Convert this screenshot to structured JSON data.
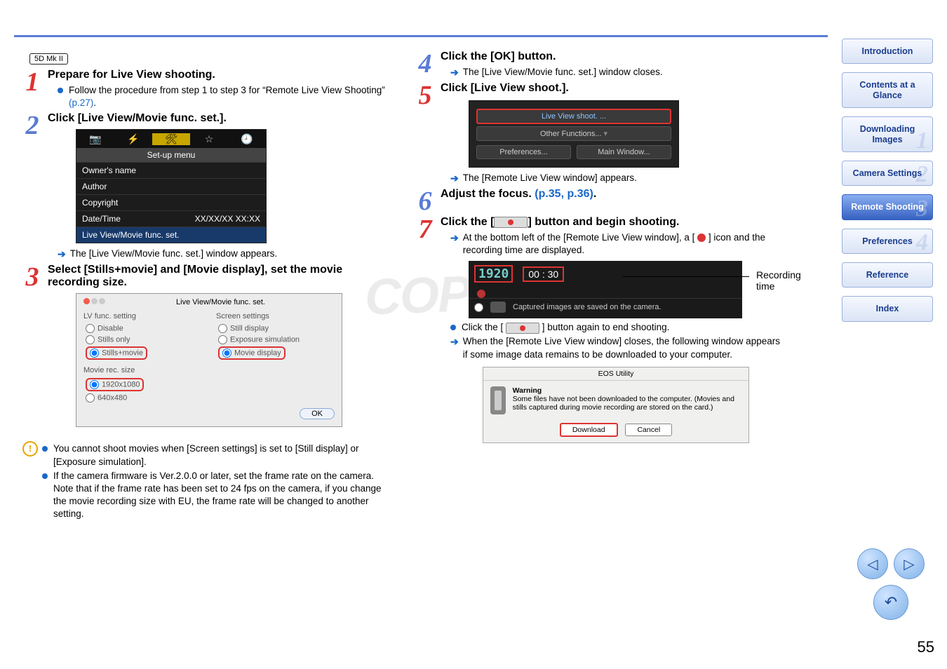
{
  "camera_badge": "5D Mk II",
  "leftcol": {
    "step1": {
      "title": "Prepare for Live View shooting.",
      "b1a": "Follow the procedure from step 1 to step 3 for “Remote Live View Shooting” ",
      "b1link": "(p.27)",
      "b1b": "."
    },
    "step2": {
      "title": "Click [Live View/Movie func. set.].",
      "sub": "The [Live View/Movie func. set.] window appears."
    },
    "step3": {
      "title": "Select [Stills+movie] and [Movie display], set the movie recording size."
    },
    "shot1": {
      "setup": "Set-up menu",
      "rows": [
        "Owner's name",
        "Author",
        "Copyright"
      ],
      "dt_label": "Date/Time",
      "dt_val": "XX/XX/XX XX:XX",
      "sel": "Live View/Movie func. set."
    },
    "shot2": {
      "title": "Live View/Movie func. set.",
      "lv_h": "LV func. setting",
      "sc_h": "Screen settings",
      "lv1": "Disable",
      "lv2": "Stills only",
      "lv3": "Stills+movie",
      "sc1": "Still display",
      "sc2": "Exposure simulation",
      "sc3": "Movie display",
      "mrs_h": "Movie rec. size",
      "mrs1": "1920x1080",
      "mrs2": "640x480",
      "ok": "OK"
    },
    "caution1": "You cannot shoot movies when [Screen settings] is set to [Still display] or [Exposure simulation].",
    "caution2": "If the camera firmware is Ver.2.0.0 or later, set the frame rate on the camera. Note that if the frame rate has been set to 24 fps on the camera, if you change the movie recording size with EU, the frame rate will be changed to another setting."
  },
  "rightcol": {
    "step4": {
      "title": "Click the [OK] button.",
      "sub": "The [Live View/Movie func. set.] window closes."
    },
    "step5": {
      "title": "Click [Live View shoot.].",
      "sub": "The [Remote Live View window] appears."
    },
    "shot3": {
      "b1": "Live View shoot. ...",
      "b2": "Other Functions...",
      "b3": "Preferences...",
      "b4": "Main Window..."
    },
    "step6": {
      "t1": "Adjust the focus. ",
      "link": "(p.35, p.36)",
      "t2": "."
    },
    "step7": {
      "t1": "Click the [",
      "t2": "] button and begin shooting.",
      "sub": "At the bottom left of the [Remote Live View window], a [        ] icon and the recording time are displayed."
    },
    "shot4": {
      "res": "1920",
      "time": "00 : 30",
      "msg": "Captured images are saved on the camera.",
      "label": "Recording time"
    },
    "after1": "Click the [            ] button again to end shooting.",
    "after2": "When the [Remote Live View window] closes, the following window appears if some image data remains to be downloaded to your computer.",
    "dlg": {
      "title": "EOS Utility",
      "h": "Warning",
      "msg": "Some files have not been downloaded to the computer. (Movies and stills captured during movie recording are stored on the card.)",
      "b1": "Download",
      "b2": "Cancel"
    }
  },
  "sidebar": {
    "intro": "Introduction",
    "contents": "Contents at a Glance",
    "dl": "Downloading Images",
    "cam": "Camera Settings",
    "remote": "Remote Shooting",
    "prefs": "Preferences",
    "ref": "Reference",
    "idx": "Index"
  },
  "watermark": "COPY",
  "page": "55"
}
